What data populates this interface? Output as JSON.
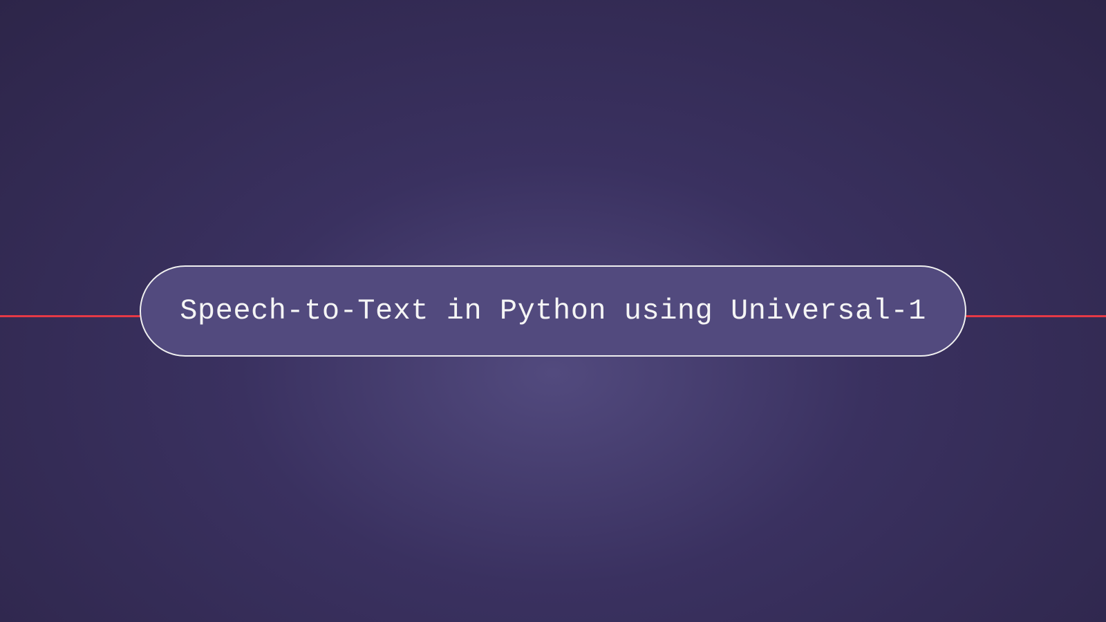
{
  "title": "Speech-to-Text in Python using Universal-1",
  "colors": {
    "background_center": "#524a7e",
    "background_edge": "#2d2549",
    "line": "#e63946",
    "border": "#f0f0f0",
    "text": "#f5f5f5"
  }
}
